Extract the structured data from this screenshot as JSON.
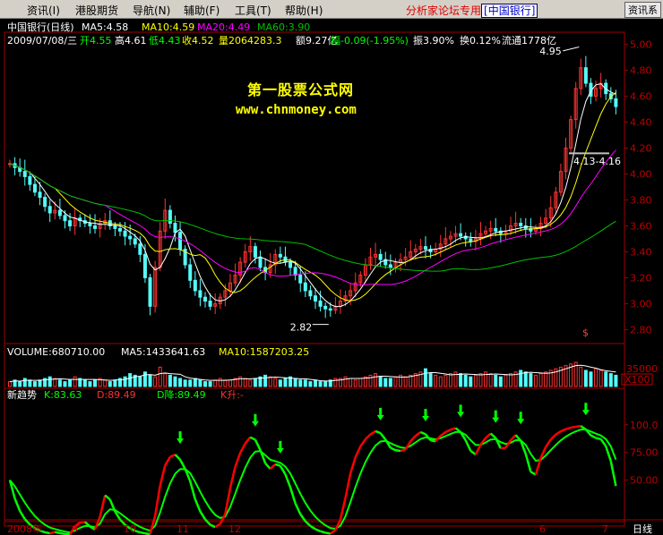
{
  "menubar": {
    "items": [
      "资讯(I)",
      "港股期货",
      "导航(N)",
      "辅助(F)",
      "工具(T)",
      "帮助(H)"
    ],
    "forum_text": "分析家论坛专用",
    "stock_name": "[中国银行]",
    "right_button": "资讯系"
  },
  "watermark": {
    "line1": "第一股票公式网",
    "line2": "www.chnmoney.com"
  },
  "colors": {
    "up": "#ff3232",
    "down": "#54fcfc",
    "ma5": "#ffffff",
    "ma10": "#ffff00",
    "ma20": "#ff00ff",
    "ma60": "#00c000",
    "kd_green": "#00ff00",
    "kd_red": "#ff0000"
  },
  "chart_data": [
    {
      "type": "candlestick",
      "title": "中国银行(日线)",
      "ma_labels": [
        "MA5:4.58",
        "MA10:4.59",
        "MA20:4.49",
        "MA60:3.90"
      ],
      "info": "2009/07/08/三",
      "quote": {
        "open": "开4.55",
        "high": "高4.61",
        "low": "低4.43",
        "close": "收4.52",
        "volume": "量2064283.3",
        "amount": "额9.27亿",
        "change": "幅-0.09(-1.95%)",
        "amplitude": "振3.90%",
        "turnover": "换0.12%",
        "float": "流通1778亿"
      },
      "yticks": [
        "5.00",
        "4.80",
        "4.60",
        "4.40",
        "4.20",
        "4.00",
        "3.80",
        "3.60",
        "3.40",
        "3.20",
        "3.00",
        "2.80"
      ],
      "ylim": [
        2.72,
        5.08
      ],
      "annotations": {
        "high": "4.95",
        "low": "2.82",
        "marker": "4.13-4.16",
        "dollar": "$"
      },
      "closes": [
        4.08,
        4.05,
        4.02,
        3.98,
        3.92,
        3.86,
        3.82,
        3.75,
        3.7,
        3.72,
        3.68,
        3.64,
        3.6,
        3.66,
        3.64,
        3.62,
        3.6,
        3.58,
        3.62,
        3.64,
        3.6,
        3.58,
        3.56,
        3.52,
        3.5,
        3.46,
        3.38,
        3.2,
        2.98,
        3.28,
        3.56,
        3.72,
        3.62,
        3.55,
        3.42,
        3.3,
        3.18,
        3.1,
        3.05,
        3.02,
        2.98,
        3.0,
        3.05,
        3.1,
        3.16,
        3.22,
        3.32,
        3.4,
        3.44,
        3.36,
        3.28,
        3.24,
        3.3,
        3.38,
        3.36,
        3.32,
        3.28,
        3.22,
        3.16,
        3.1,
        3.06,
        3.02,
        2.98,
        2.96,
        2.95,
        2.98,
        3.02,
        3.06,
        3.1,
        3.16,
        3.22,
        3.3,
        3.36,
        3.38,
        3.34,
        3.3,
        3.28,
        3.32,
        3.34,
        3.36,
        3.4,
        3.42,
        3.44,
        3.42,
        3.4,
        3.42,
        3.46,
        3.5,
        3.52,
        3.54,
        3.52,
        3.5,
        3.48,
        3.5,
        3.54,
        3.56,
        3.58,
        3.56,
        3.54,
        3.56,
        3.6,
        3.62,
        3.6,
        3.58,
        3.56,
        3.58,
        3.62,
        3.66,
        3.74,
        3.86,
        4.02,
        4.2,
        4.42,
        4.66,
        4.82,
        4.7,
        4.6,
        4.66,
        4.7,
        4.62,
        4.58,
        4.52
      ]
    },
    {
      "type": "bar",
      "title": "VOLUME:680710.00",
      "ma_labels": [
        "MA5:1433641.63",
        "MA10:1587203.25"
      ],
      "unit": "X100",
      "ytick": "35000",
      "values": [
        3,
        4,
        3,
        5,
        4,
        3,
        4,
        5,
        6,
        5,
        4,
        3,
        4,
        6,
        5,
        4,
        3,
        4,
        5,
        4,
        3,
        4,
        5,
        6,
        8,
        7,
        6,
        9,
        7,
        6,
        12,
        8,
        7,
        6,
        5,
        4,
        4,
        5,
        4,
        3,
        3,
        4,
        5,
        4,
        4,
        5,
        6,
        5,
        4,
        5,
        6,
        7,
        6,
        5,
        4,
        5,
        6,
        5,
        4,
        4,
        3,
        4,
        3,
        3,
        4,
        5,
        5,
        6,
        5,
        4,
        5,
        6,
        7,
        8,
        6,
        5,
        5,
        6,
        7,
        6,
        7,
        8,
        9,
        11,
        8,
        7,
        6,
        7,
        8,
        9,
        8,
        7,
        6,
        7,
        8,
        9,
        8,
        7,
        6,
        7,
        8,
        9,
        10,
        9,
        8,
        7,
        8,
        9,
        10,
        11,
        12,
        13,
        14,
        15,
        12,
        10,
        9,
        11,
        10,
        9,
        8,
        7
      ]
    },
    {
      "type": "line",
      "title": "新趋势",
      "labels": [
        "K:83.63",
        "D:89.49",
        "D降:89.49",
        "K升:-"
      ],
      "yticks": [
        "100.0",
        "75.00",
        "50.00"
      ],
      "ylim": [
        15,
        120
      ],
      "x_labels": [
        "2008年",
        "9",
        "10",
        "11",
        "12",
        "6",
        "7"
      ],
      "period": "日线"
    }
  ]
}
